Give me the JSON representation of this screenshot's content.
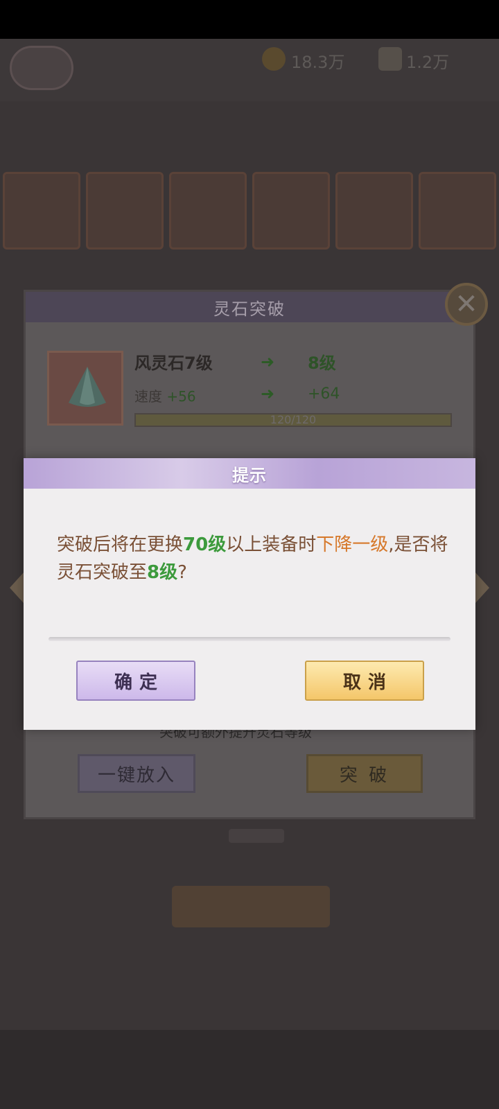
{
  "background": {
    "coin_value": "18.3万",
    "gem_value": "1.2万"
  },
  "panel": {
    "title": "灵石突破",
    "stone_name": "风灵石7级",
    "next_level": "8级",
    "attr_name": "速度",
    "attr_current": "+56",
    "attr_next": "+64",
    "arrow": "➜",
    "progress_text": "120/120",
    "progress": 1.0,
    "hint": "突破可额外提升灵石等级",
    "put_all_button": "一键放入",
    "break_button": "突 破",
    "close_glyph": "✕"
  },
  "modal": {
    "title": "提示",
    "message_parts": {
      "p1": "突破后将在更换",
      "p2": "70级",
      "p3": "以上装备时",
      "p4": "下降一级",
      "p5": ",是否将灵石突破至",
      "p6": "8级",
      "p7": "?"
    },
    "confirm_button": "确定",
    "cancel_button": "取消"
  },
  "colors": {
    "modal_header": "#b8a3d7",
    "highlight_green": "#3c9a3c",
    "highlight_orange": "#d6782a",
    "body_text": "#7a5036"
  }
}
